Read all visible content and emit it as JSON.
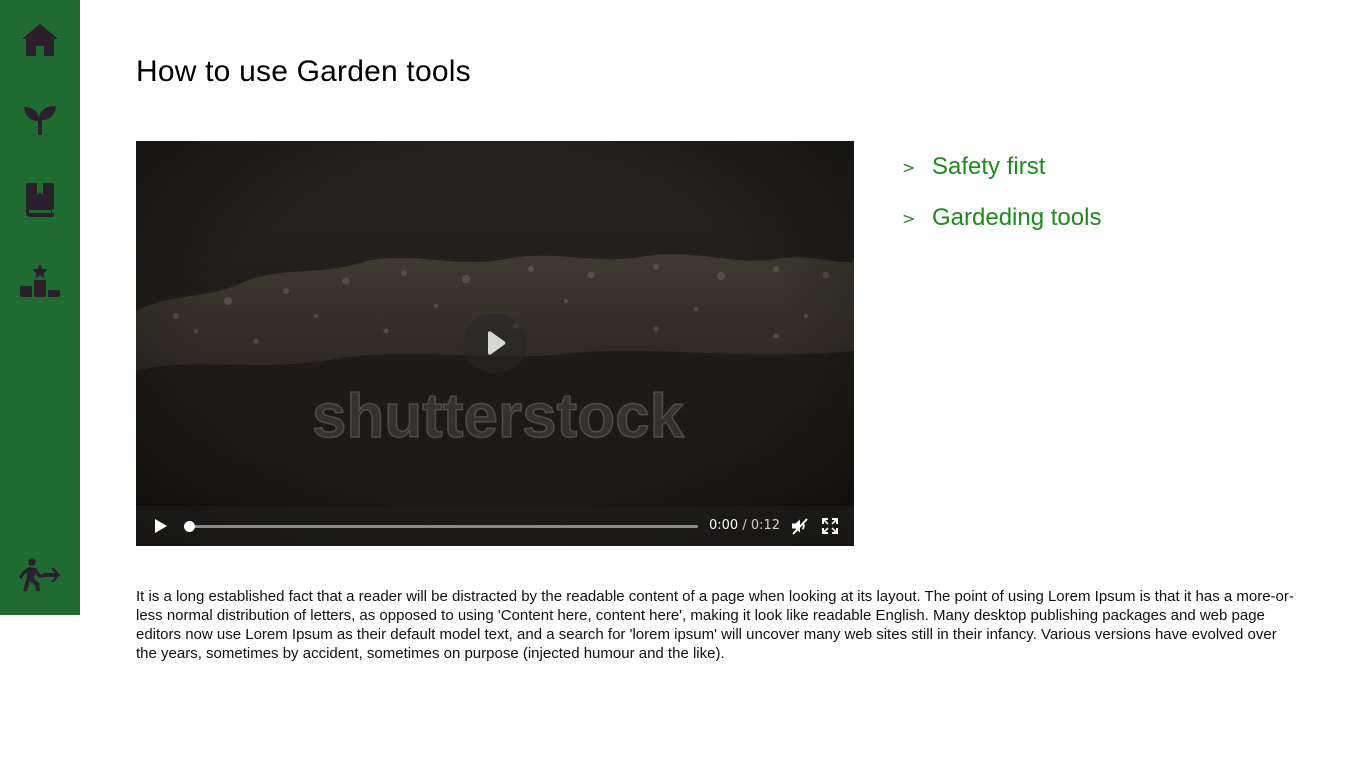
{
  "sidebar": {
    "items": [
      {
        "icon": "home-icon"
      },
      {
        "icon": "sprout-icon"
      },
      {
        "icon": "book-bookmark-icon"
      },
      {
        "icon": "ranking-podium-icon"
      }
    ],
    "exit_icon": "exit-run-icon"
  },
  "page": {
    "title": "How to use Garden tools"
  },
  "video": {
    "watermark": "shutterstock",
    "current_time": "0:00",
    "separator": " / ",
    "duration": "0:12",
    "progress": 0,
    "muted": true
  },
  "toc": {
    "chevron": ">",
    "items": [
      {
        "label": "Safety first"
      },
      {
        "label": "Gardeding tools"
      }
    ]
  },
  "body": {
    "paragraph": "It is a long established fact that a reader will be distracted by the readable content of a page when looking at its layout. The point of using Lorem Ipsum is that it has a more-or-less normal distribution of letters, as opposed to using 'Content here, content here', making it look like readable English. Many desktop publishing packages and web page editors now use Lorem Ipsum as their default model text, and a search for 'lorem ipsum' will uncover many web sites still in their infancy. Various versions have evolved over the years, sometimes by accident, sometimes on purpose (injected humour and the like)."
  },
  "colors": {
    "sidebar_bg": "#1f6b32",
    "sidebar_icon": "#2a1f2a",
    "link": "#1e8a1e"
  }
}
